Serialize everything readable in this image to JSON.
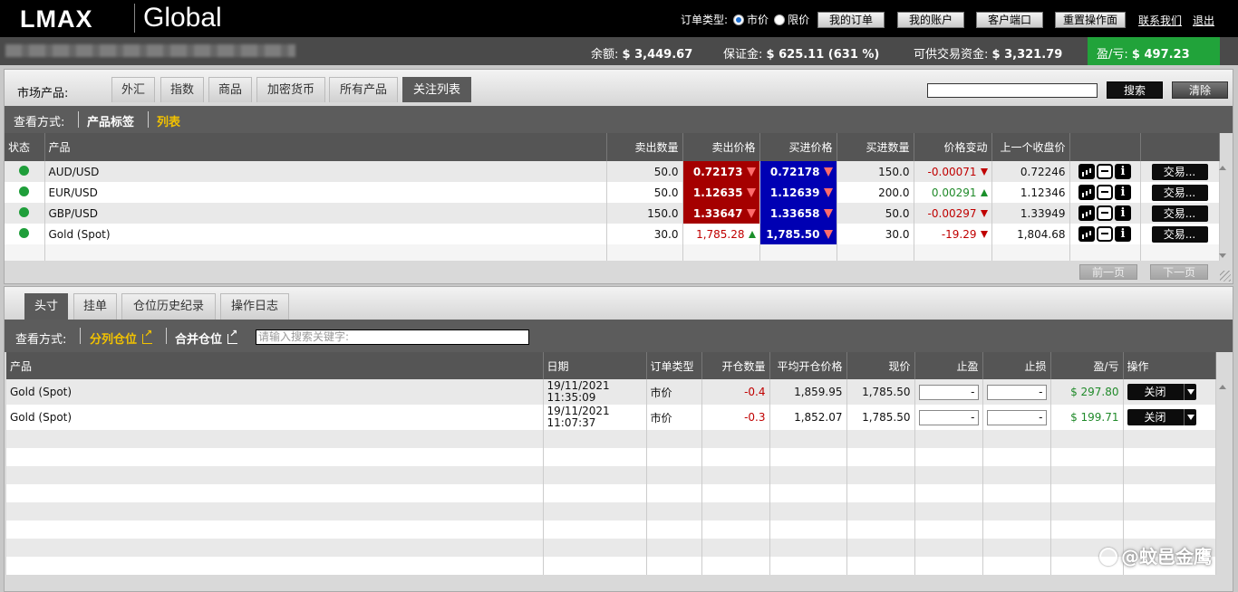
{
  "header": {
    "logo_lmax": "LMAX",
    "logo_global": "Global",
    "order_type_label": "订单类型:",
    "market_option": "市价",
    "limit_option": "限价",
    "buttons": [
      "我的订单",
      "我的账户",
      "客户端口",
      "重置操作面"
    ],
    "links": [
      "联系我们",
      "退出"
    ]
  },
  "account": {
    "balance_label": "余额:",
    "balance_value": "$ 3,449.67",
    "margin_label": "保证金:",
    "margin_value": "$ 625.11 (631 %)",
    "available_label": "可供交易资金:",
    "available_value": "$ 3,321.79",
    "pnl_label": "盈/亏:",
    "pnl_value": "$ 497.23",
    "pnl_color": "#21a33a"
  },
  "market": {
    "label": "市场产品:",
    "tabs": [
      "外汇",
      "指数",
      "商品",
      "加密货币",
      "所有产品",
      "关注列表"
    ],
    "active_tab": "关注列表",
    "search_button": "搜索",
    "clear_button": "清除",
    "view_label": "查看方式:",
    "view_options": [
      "产品标签",
      "列表"
    ],
    "columns": [
      "状态",
      "产品",
      "卖出数量",
      "卖出价格",
      "买进价格",
      "买进数量",
      "价格变动",
      "上一个收盘价"
    ],
    "rows": [
      {
        "product": "AUD/USD",
        "sell_qty": "50.0",
        "sell_price": "0.72173",
        "buy_price": "0.72178",
        "buy_qty": "150.0",
        "change": "-0.00071",
        "prev_close": "0.72246"
      },
      {
        "product": "EUR/USD",
        "sell_qty": "50.0",
        "sell_price": "1.12635",
        "buy_price": "1.12639",
        "buy_qty": "200.0",
        "change": "0.00291",
        "prev_close": "1.12346"
      },
      {
        "product": "GBP/USD",
        "sell_qty": "150.0",
        "sell_price": "1.33647",
        "buy_price": "1.33658",
        "buy_qty": "50.0",
        "change": "-0.00297",
        "prev_close": "1.33949"
      },
      {
        "product": "Gold (Spot)",
        "sell_qty": "30.0",
        "sell_price": "1,785.28",
        "buy_price": "1,785.50",
        "buy_qty": "30.0",
        "change": "-19.29",
        "prev_close": "1,804.68"
      }
    ],
    "trade_label": "交易...",
    "prev_page": "前一页",
    "next_page": "下一页",
    "sell_color": "#a50000",
    "buy_color": "#0000b3"
  },
  "positions": {
    "tabs": [
      "头寸",
      "挂单",
      "仓位历史纪录",
      "操作日志"
    ],
    "active_tab": "头寸",
    "view_label": "查看方式:",
    "view_options": [
      "分列仓位",
      "合并仓位"
    ],
    "search_placeholder": "请输入搜索关键字:",
    "columns": [
      "产品",
      "日期",
      "订单类型",
      "开仓数量",
      "平均开仓价格",
      "现价",
      "止盈",
      "止损",
      "盈/亏",
      "操作"
    ],
    "rows": [
      {
        "product": "Gold (Spot)",
        "date": "19/11/2021",
        "time": "11:35:09",
        "type": "市价",
        "qty": "-0.4",
        "avg_price": "1,859.95",
        "price": "1,785.50",
        "tp": "-",
        "sl": "-",
        "pnl": "$ 297.80",
        "action": "关闭"
      },
      {
        "product": "Gold (Spot)",
        "date": "19/11/2021",
        "time": "11:07:37",
        "type": "市价",
        "qty": "-0.3",
        "avg_price": "1,852.07",
        "price": "1,785.50",
        "tp": "-",
        "sl": "-",
        "pnl": "$ 199.71",
        "action": "关闭"
      }
    ]
  },
  "watermark": "@蚊邑金鹰"
}
